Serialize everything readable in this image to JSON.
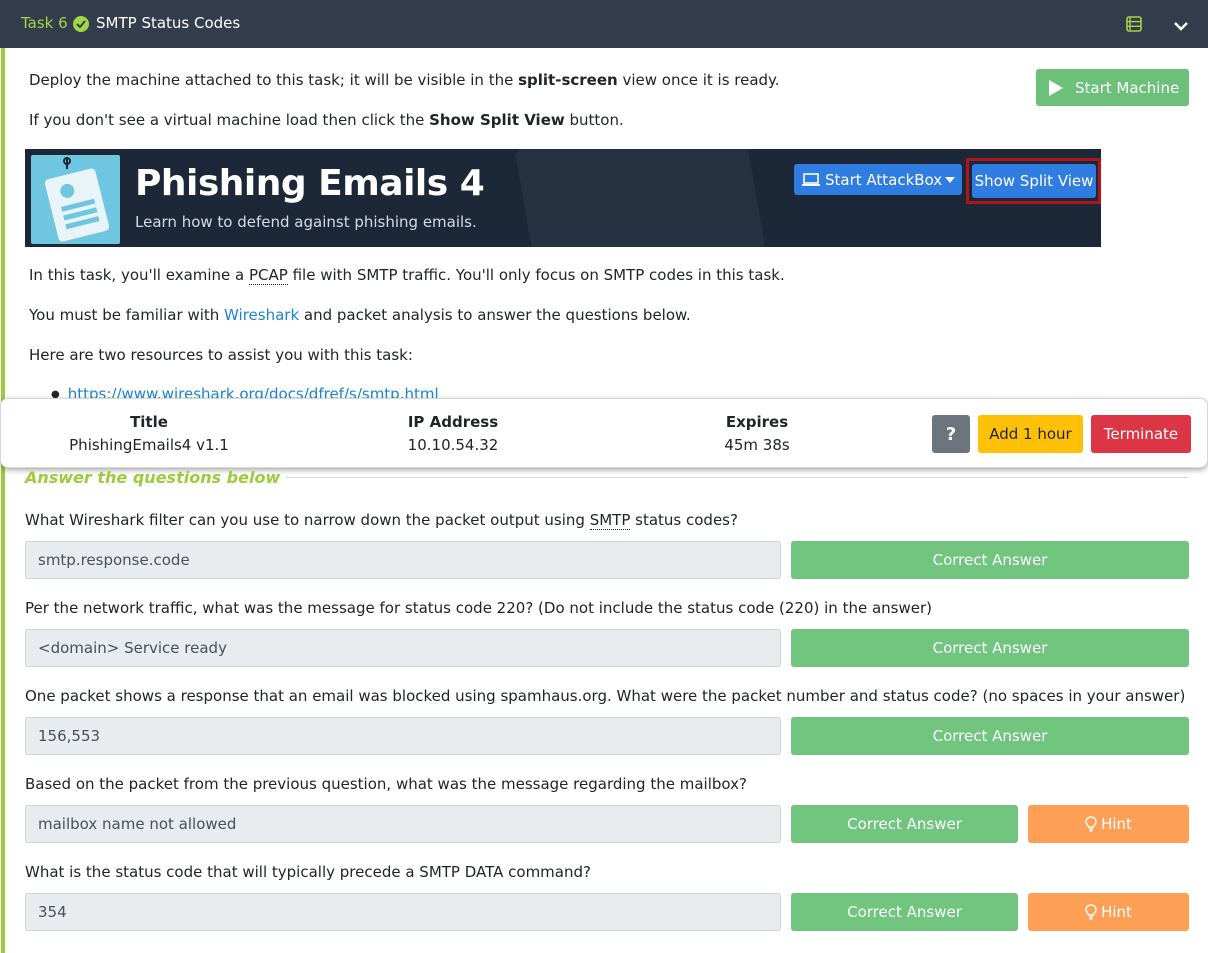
{
  "header": {
    "task_number": "Task 6",
    "title": "SMTP Status Codes"
  },
  "intro": {
    "p1_before": "Deploy the machine attached to this task; it will be visible in the ",
    "p1_bold": "split-screen",
    "p1_after": " view once it is ready.",
    "p2_before": "If you don't see a virtual machine load then click the ",
    "p2_bold": "Show Split View",
    "p2_after": " button.",
    "start_machine_label": "Start Machine"
  },
  "banner": {
    "title": "Phishing Emails 4",
    "subtitle": "Learn how to defend against phishing emails.",
    "attackbox_label": "Start AttackBox",
    "split_view_label": "Show Split View"
  },
  "body": {
    "p3_before": "In this task, you'll examine a ",
    "p3_abbr": "PCAP",
    "p3_after": " file with SMTP traffic. You'll only focus on SMTP codes in this task.",
    "p4_before": "You must be familiar with ",
    "p4_link": "Wireshark",
    "p4_after": " and packet analysis to answer the questions below.",
    "p5": "Here are two resources to assist you with this task:",
    "resource_link": "https://www.wireshark.org/docs/dfref/s/smtp.html"
  },
  "machine": {
    "title_label": "Title",
    "title_value": "PhishingEmails4 v1.1",
    "ip_label": "IP Address",
    "ip_value": "10.10.54.32",
    "expires_label": "Expires",
    "expires_value": "45m 38s",
    "help_label": "?",
    "add_hour_label": "Add 1 hour",
    "terminate_label": "Terminate"
  },
  "answers_heading": "Answer the questions below",
  "questions": [
    {
      "text_before": "What Wireshark filter can you use to narrow down the packet output using ",
      "abbr": "SMTP",
      "text_after": " status codes?",
      "answer": "smtp.response.code",
      "button": "Correct Answer"
    },
    {
      "text": "Per the network traffic, what was the message for status code 220? (Do not include the status code (220) in the answer)",
      "answer": "<domain> Service ready",
      "button": "Correct Answer"
    },
    {
      "text": "One packet shows a response that an email was blocked using spamhaus.org. What were the packet number and status code? (no spaces in your answer)",
      "answer": "156,553",
      "button": "Correct Answer"
    },
    {
      "text": "Based on the packet from the previous question, what was the message regarding the mailbox?",
      "answer": "mailbox name not allowed",
      "button": "Correct Answer",
      "hint": "Hint"
    },
    {
      "text": "What is the status code that will typically precede a SMTP DATA command?",
      "answer": "354",
      "button": "Correct Answer",
      "hint": "Hint"
    }
  ],
  "colors": {
    "header_bg": "#343d4b",
    "accent_green": "#9ccc3c",
    "correct_green": "#72c57f",
    "hint_orange": "#fd9f55",
    "primary_blue": "#2f7de1",
    "terminate_red": "#dc3545",
    "add_hour_yellow": "#ffc107"
  }
}
